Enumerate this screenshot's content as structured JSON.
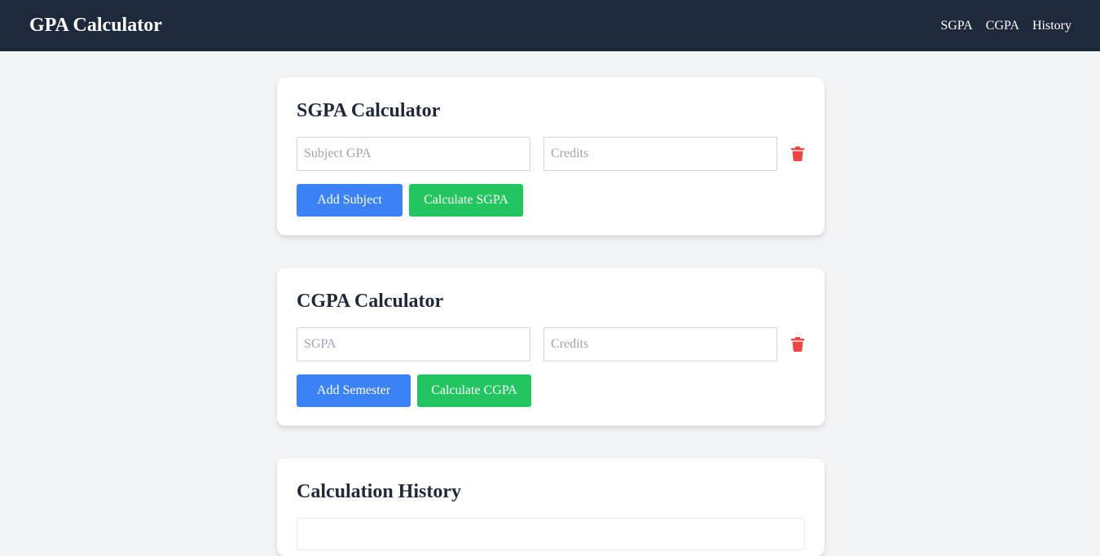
{
  "header": {
    "brand": "GPA Calculator",
    "nav": [
      {
        "label": "SGPA"
      },
      {
        "label": "CGPA"
      },
      {
        "label": "History"
      }
    ]
  },
  "sgpa": {
    "title": "SGPA Calculator",
    "gpa_placeholder": "Subject GPA",
    "gpa_value": "",
    "credits_placeholder": "Credits",
    "credits_value": "",
    "add_label": "Add Subject",
    "calc_label": "Calculate SGPA"
  },
  "cgpa": {
    "title": "CGPA Calculator",
    "sgpa_placeholder": "SGPA",
    "sgpa_value": "",
    "credits_placeholder": "Credits",
    "credits_value": "",
    "add_label": "Add Semester",
    "calc_label": "Calculate CGPA"
  },
  "history": {
    "title": "Calculation History"
  },
  "colors": {
    "navbar": "#1e293b",
    "primary_blue": "#3b82f6",
    "success_green": "#22c55e",
    "danger_red": "#ef4444",
    "page_bg": "#f3f4f6"
  },
  "icons": {
    "delete": "trash-icon"
  }
}
